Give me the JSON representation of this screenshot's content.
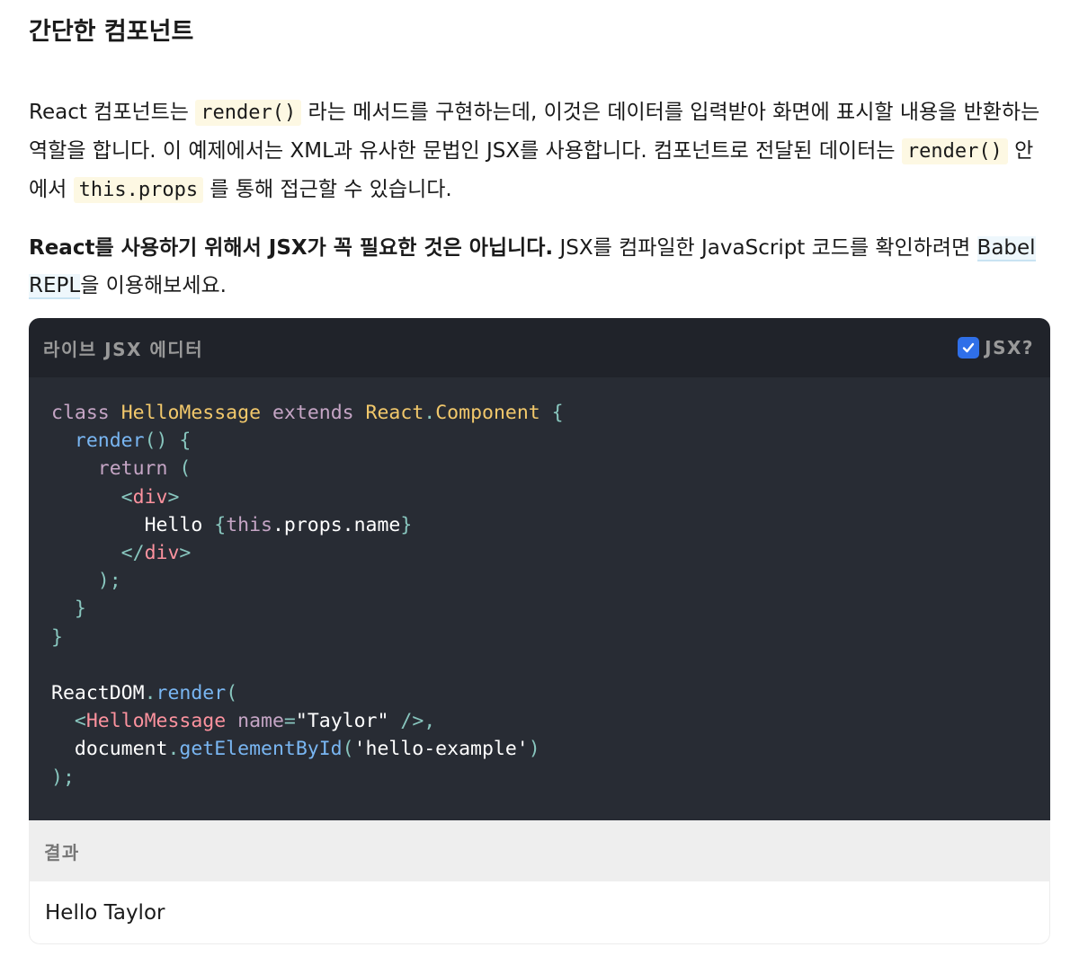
{
  "section": {
    "title": "간단한 컴포넌트"
  },
  "paragraph1": {
    "t1": "React 컴포넌트는 ",
    "code1": "render()",
    "t2": " 라는 메서드를 구현하는데, 이것은 데이터를 입력받아 화면에 표시할 내용을 반환하는 역할을 합니다. 이 예제에서는 XML과 유사한 문법인 JSX를 사용합니다. 컴포넌트로 전달된 데이터는 ",
    "code2": "render()",
    "t3": " 안에서 ",
    "code3": "this.props",
    "t4": " 를 통해 접근할 수 있습니다."
  },
  "paragraph2": {
    "bold": "React를 사용하기 위해서 JSX가 꼭 필요한 것은 아닙니다.",
    "t1": " JSX를 컴파일한 JavaScript 코드를 확인하려면 ",
    "link": "Babel REPL",
    "t2": "을 이용해보세요."
  },
  "editor": {
    "title": "라이브 JSX 에디터",
    "jsx_toggle_label": "JSX?",
    "jsx_checked": true,
    "code": {
      "l1": {
        "class": "class",
        "name": "HelloMessage",
        "extends": "extends",
        "parent": "React",
        "dot": ".",
        "comp": "Component",
        "brace": " {"
      },
      "l2": {
        "fn": "render",
        "rest": "() {"
      },
      "l3": {
        "ret": "return",
        "paren": " ("
      },
      "l4": {
        "open": "<",
        "tag": "div",
        "close": ">"
      },
      "l5": {
        "hello": "Hello ",
        "ob": "{",
        "this": "this",
        "props": ".props.name",
        "cb": "}"
      },
      "l6": {
        "open": "</",
        "tag": "div",
        "close": ">"
      },
      "l7": ");",
      "l8": "}",
      "l9": "}",
      "l11": {
        "obj": "ReactDOM",
        "dot": ".",
        "fn": "render",
        "paren": "("
      },
      "l12": {
        "open": "<",
        "tag": "HelloMessage",
        "attr": "name",
        "eq": "=",
        "str": "\"Taylor\"",
        "close": " />,"
      },
      "l13": {
        "obj": "document",
        "dot": ".",
        "fn": "getElementById",
        "paren": "(",
        "str": "'hello-example'",
        "cparen": ")"
      },
      "l14": ");"
    }
  },
  "result": {
    "title": "결과",
    "output": "Hello Taylor"
  },
  "colors": {
    "editor_header_bg": "#20232a",
    "code_bg": "#282c34",
    "checkbox": "#2f6fe8",
    "inline_code_bg": "#fdf8e3"
  }
}
